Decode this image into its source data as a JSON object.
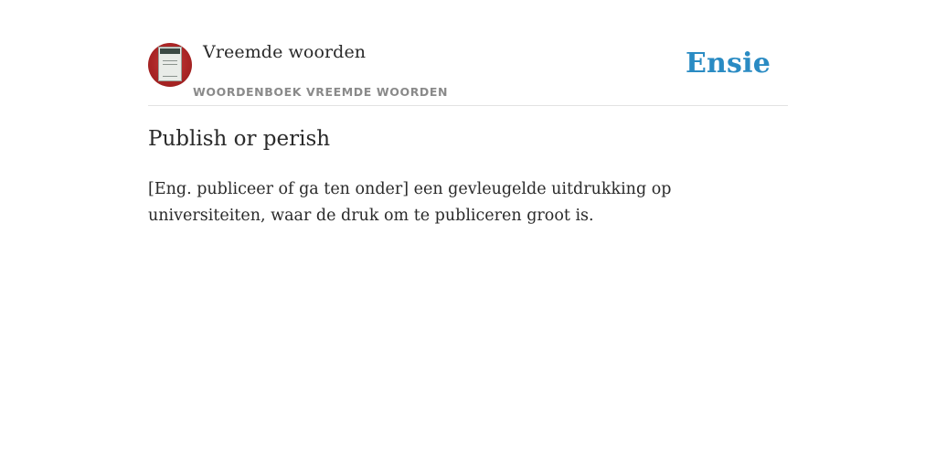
{
  "header": {
    "site_title": "Vreemde woorden",
    "site_subtitle": "WOORDENBOEK VREEMDE WOORDEN",
    "brand": "Ensie",
    "avatar_icon": "book-cover-icon"
  },
  "entry": {
    "title": "Publish or perish",
    "definition": "[Eng. publiceer of ga ten onder] een gevleugelde uitdrukking op universiteiten, waar de druk om te publiceren groot is."
  },
  "colors": {
    "brand": "#2a8bc3",
    "avatar": "#a82424",
    "subtitle": "#8a8a8a",
    "divider": "#e2e2e2"
  }
}
